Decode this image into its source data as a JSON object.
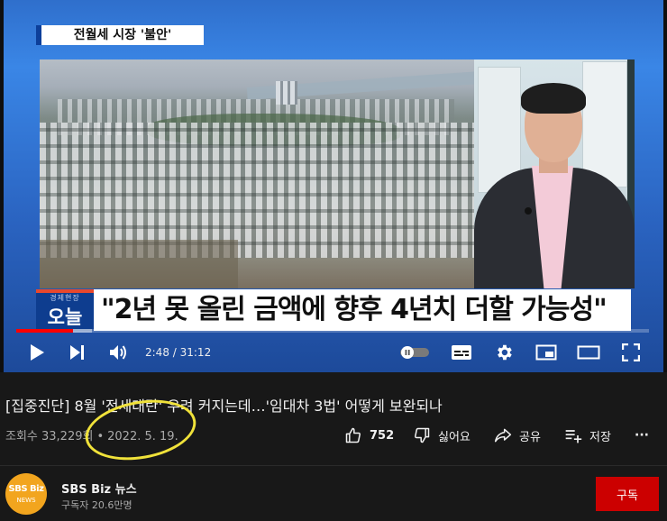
{
  "player": {
    "top_caption": "전월세 시장 '불안'",
    "lower_third": {
      "logo_small": "경제현장",
      "logo_big": "오늘",
      "headline": "\"2년 못 올린 금액에 향후 4년치 더할 가능성\""
    },
    "time_display": "2:48 / 31:12",
    "progress": {
      "played_fraction": 0.09,
      "loaded_fraction": 0.12
    },
    "icons": {
      "play": "play-icon",
      "next": "next-icon",
      "volume": "volume-icon",
      "autoplay": "autoplay-toggle-icon",
      "subtitles": "subtitles-icon",
      "settings": "gear-icon",
      "miniplayer": "miniplayer-icon",
      "theater": "theater-mode-icon",
      "fullscreen": "fullscreen-icon"
    }
  },
  "video": {
    "title": "[집중진단] 8월 '전세대란' 우려 커지는데…'임대차 3법' 어떻게 보완되나",
    "views": "조회수 33,229회",
    "separator": "•",
    "date": "2022. 5. 19."
  },
  "actions": {
    "like_count": "752",
    "dislike_label": "싫어요",
    "share_label": "공유",
    "save_label": "저장",
    "more_label": "···"
  },
  "channel": {
    "avatar_text": "SBS Biz",
    "avatar_sub": "NEWS",
    "name": "SBS Biz 뉴스",
    "subscribers": "구독자 20.6만명",
    "subscribe_label": "구독"
  },
  "colors": {
    "background": "#181818",
    "progress_played": "#ff0000",
    "subscribe": "#cc0000",
    "annotation_circle": "#f0e23a",
    "avatar": "#f2a51e"
  }
}
